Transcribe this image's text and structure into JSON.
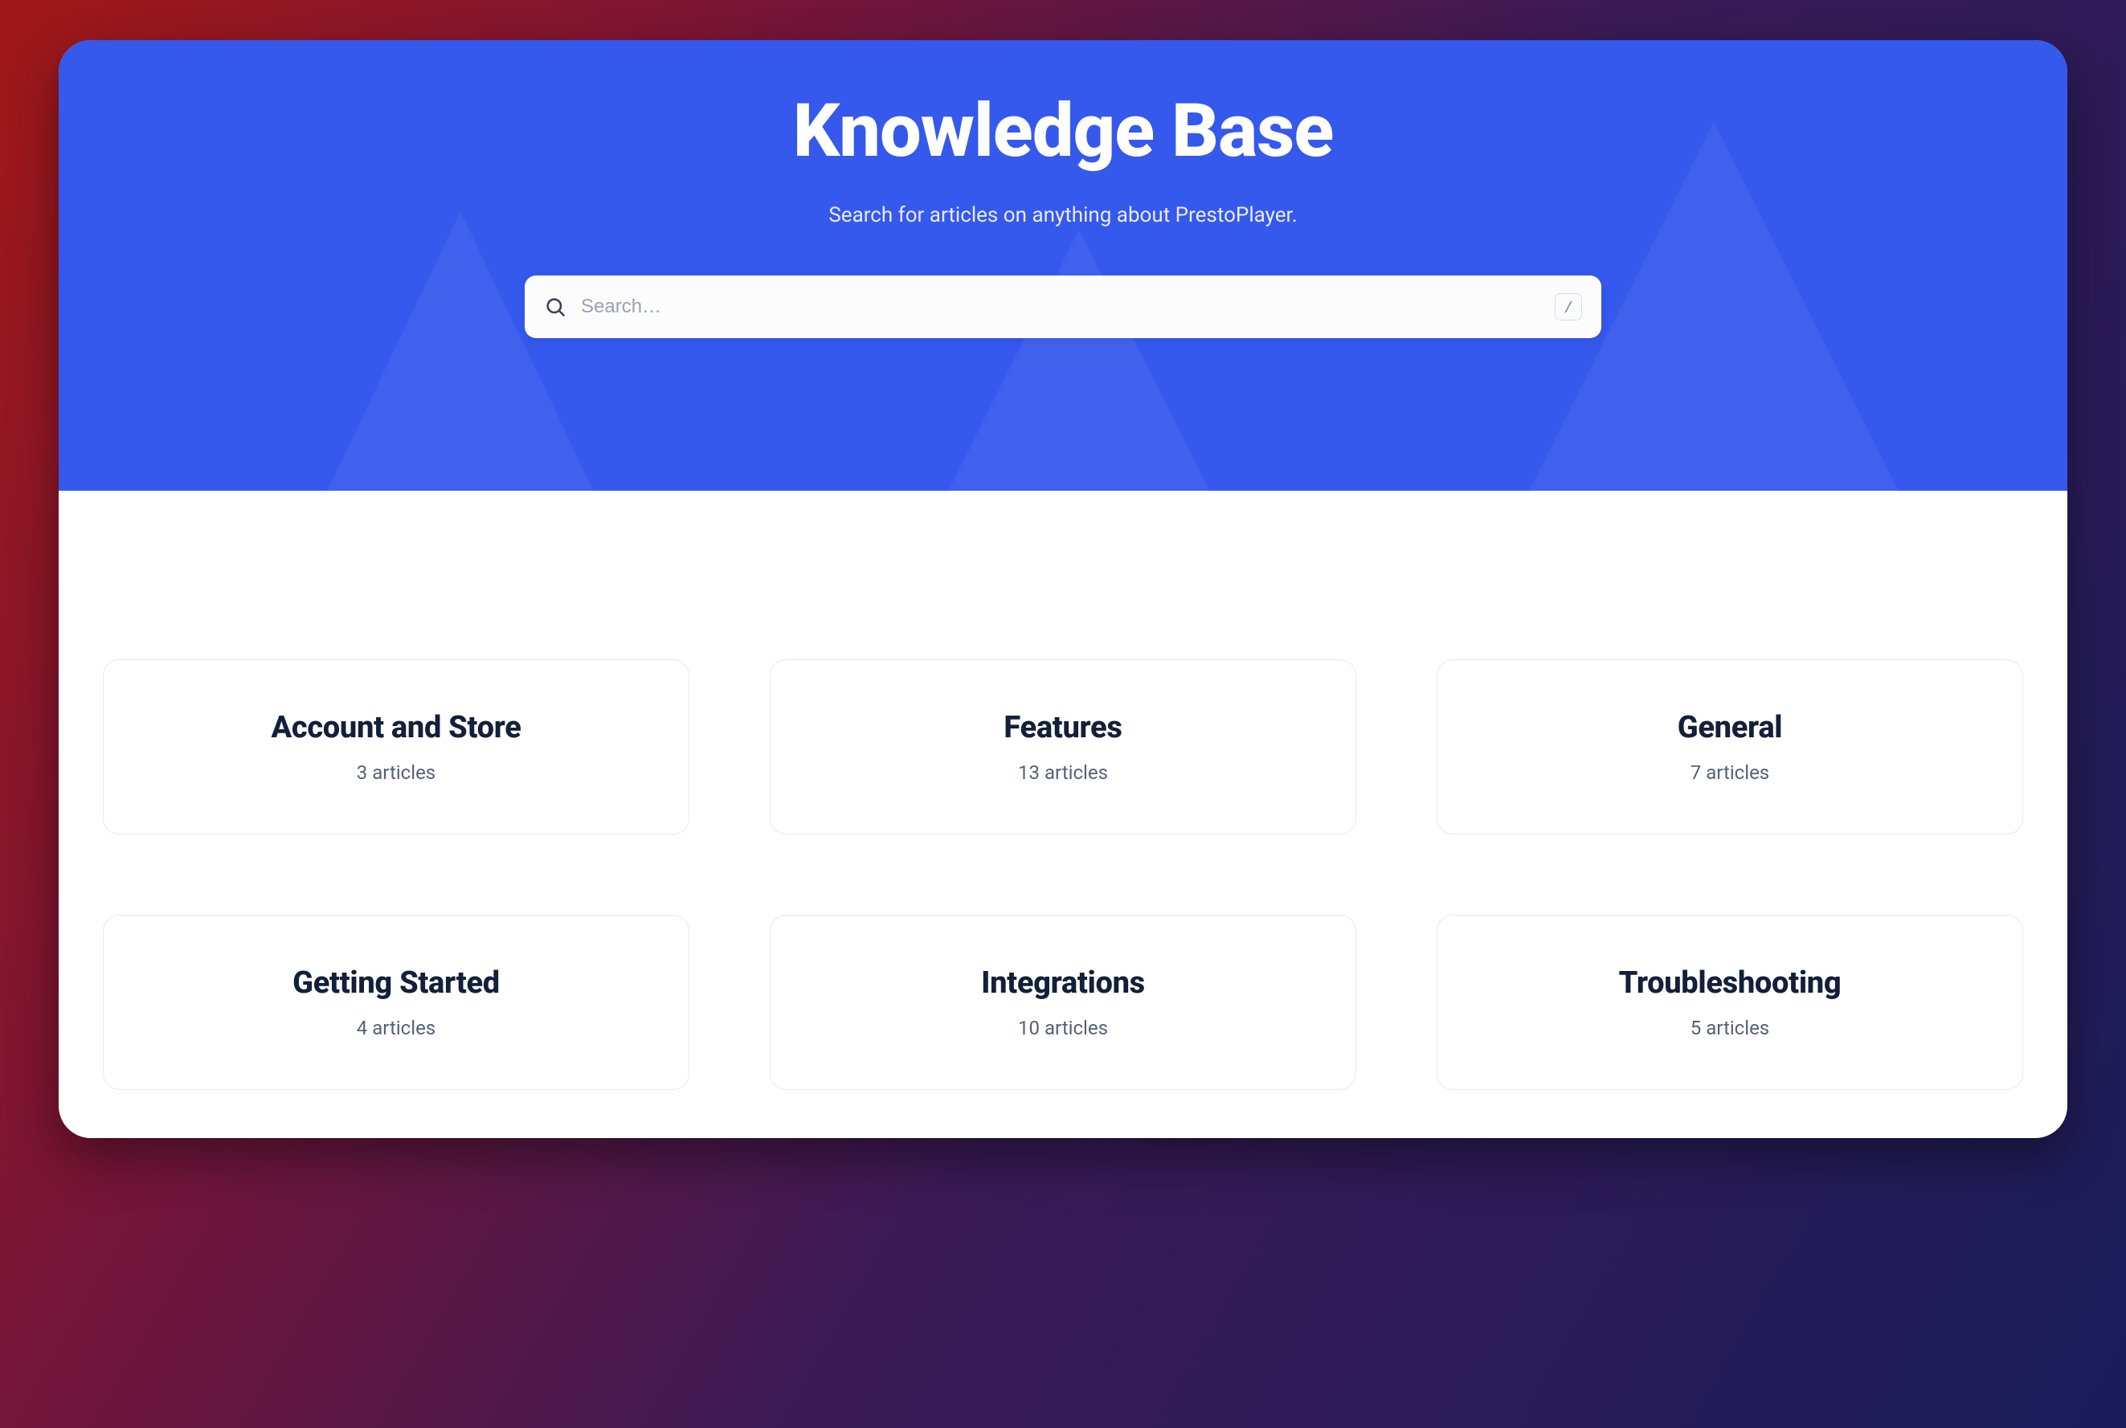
{
  "hero": {
    "title": "Knowledge Base",
    "subtitle": "Search for articles on anything about PrestoPlayer."
  },
  "search": {
    "placeholder": "Search…",
    "value": "",
    "shortcut_key": "/"
  },
  "categories": [
    {
      "title": "Account and Store",
      "count_text": "3 articles"
    },
    {
      "title": "Features",
      "count_text": "13 articles"
    },
    {
      "title": "General",
      "count_text": "7 articles"
    },
    {
      "title": "Getting Started",
      "count_text": "4 articles"
    },
    {
      "title": "Integrations",
      "count_text": "10 articles"
    },
    {
      "title": "Troubleshooting",
      "count_text": "5 articles"
    }
  ]
}
